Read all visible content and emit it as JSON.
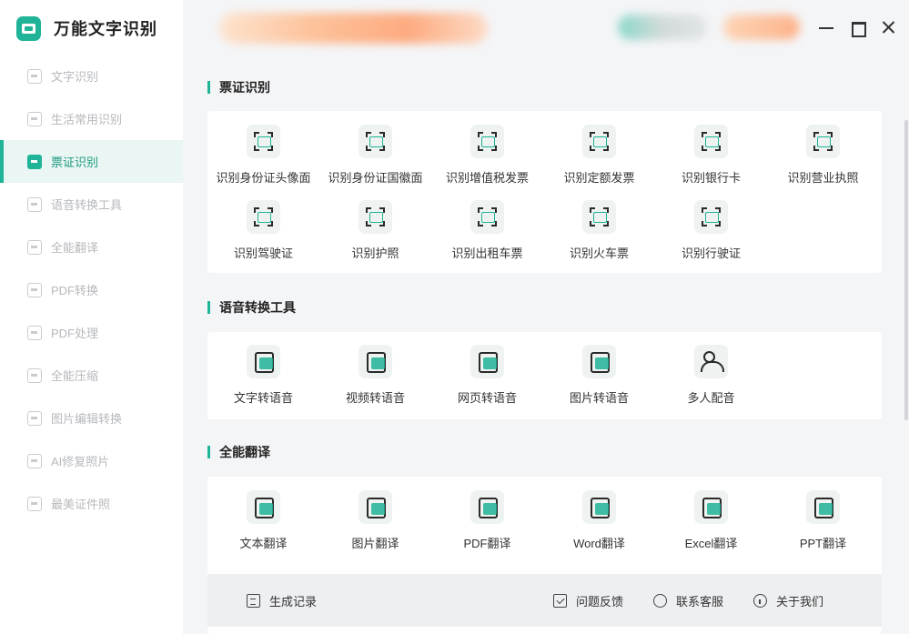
{
  "app": {
    "title": "万能文字识别"
  },
  "sidebar": {
    "items": [
      {
        "label": "文字识别",
        "icon": "text-scan-icon",
        "active": false
      },
      {
        "label": "生活常用识别",
        "icon": "life-scan-icon",
        "active": false
      },
      {
        "label": "票证识别",
        "icon": "ticket-scan-icon",
        "active": true
      },
      {
        "label": "语音转换工具",
        "icon": "voice-icon",
        "active": false
      },
      {
        "label": "全能翻译",
        "icon": "translate-icon",
        "active": false
      },
      {
        "label": "PDF转换",
        "icon": "pdf-convert-icon",
        "active": false
      },
      {
        "label": "PDF处理",
        "icon": "pdf-process-icon",
        "active": false
      },
      {
        "label": "全能压缩",
        "icon": "compress-icon",
        "active": false
      },
      {
        "label": "图片编辑转换",
        "icon": "image-edit-icon",
        "active": false
      },
      {
        "label": "AI修复照片",
        "icon": "ai-repair-icon",
        "active": false
      },
      {
        "label": "最美证件照",
        "icon": "id-photo-icon",
        "active": false
      }
    ]
  },
  "sections": [
    {
      "title": "票证识别",
      "tools": [
        {
          "label": "识别身份证头像面",
          "icon": "id-card-front-icon",
          "style": "scan"
        },
        {
          "label": "识别身份证国徽面",
          "icon": "id-card-back-icon",
          "style": "scan"
        },
        {
          "label": "识别增值税发票",
          "icon": "vat-invoice-icon",
          "style": "scan"
        },
        {
          "label": "识别定额发票",
          "icon": "quota-invoice-icon",
          "style": "scan"
        },
        {
          "label": "识别银行卡",
          "icon": "bank-card-icon",
          "style": "scan"
        },
        {
          "label": "识别营业执照",
          "icon": "business-license-icon",
          "style": "scan"
        },
        {
          "label": "识别驾驶证",
          "icon": "driver-license-icon",
          "style": "scan"
        },
        {
          "label": "识别护照",
          "icon": "passport-icon",
          "style": "scan"
        },
        {
          "label": "识别出租车票",
          "icon": "taxi-ticket-icon",
          "style": "scan"
        },
        {
          "label": "识别火车票",
          "icon": "train-ticket-icon",
          "style": "scan"
        },
        {
          "label": "识别行驶证",
          "icon": "vehicle-license-icon",
          "style": "scan"
        }
      ]
    },
    {
      "title": "语音转换工具",
      "tools": [
        {
          "label": "文字转语音",
          "icon": "text-to-speech-icon",
          "style": "doc"
        },
        {
          "label": "视频转语音",
          "icon": "video-to-speech-icon",
          "style": "doc"
        },
        {
          "label": "网页转语音",
          "icon": "web-to-speech-icon",
          "style": "doc"
        },
        {
          "label": "图片转语音",
          "icon": "image-to-speech-icon",
          "style": "doc"
        },
        {
          "label": "多人配音",
          "icon": "multi-voice-icon",
          "style": "people"
        }
      ]
    },
    {
      "title": "全能翻译",
      "tools": [
        {
          "label": "文本翻译",
          "icon": "text-translate-icon",
          "style": "doc"
        },
        {
          "label": "图片翻译",
          "icon": "image-translate-icon",
          "style": "doc"
        },
        {
          "label": "PDF翻译",
          "icon": "pdf-translate-icon",
          "style": "doc"
        },
        {
          "label": "Word翻译",
          "icon": "word-translate-icon",
          "style": "doc"
        },
        {
          "label": "Excel翻译",
          "icon": "excel-translate-icon",
          "style": "doc"
        },
        {
          "label": "PPT翻译",
          "icon": "ppt-translate-icon",
          "style": "doc"
        }
      ]
    }
  ],
  "footer": {
    "history": "生成记录",
    "feedback": "问题反馈",
    "support": "联系客服",
    "about": "关于我们"
  },
  "colors": {
    "accent": "#1fb497",
    "active_bg": "#e9f6f3"
  }
}
